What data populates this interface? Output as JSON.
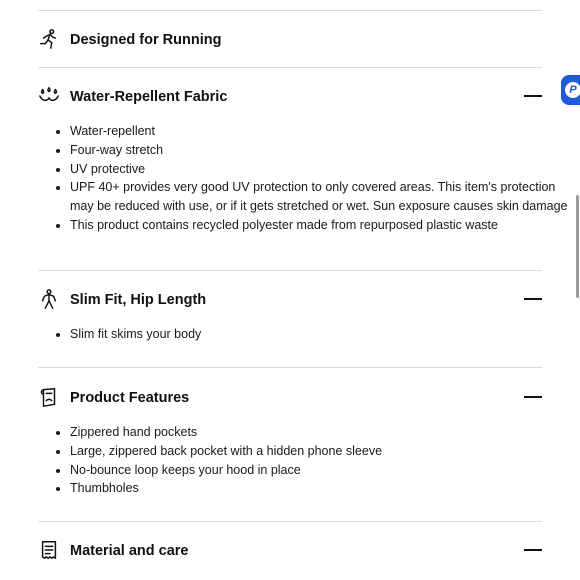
{
  "sections": [
    {
      "title": "Designed for Running",
      "icon": "running-person-icon"
    },
    {
      "title": "Water-Repellent Fabric",
      "icon": "water-drops-icon",
      "expanded": true,
      "items": [
        "Water-repellent",
        "Four-way stretch",
        "UV protective",
        "UPF 40+ provides very good UV protection to only covered areas. This item's protection may be reduced with use, or if it gets stretched or wet. Sun exposure causes skin damage",
        "This product contains recycled polyester made from repurposed plastic waste"
      ]
    },
    {
      "title": "Slim Fit, Hip Length",
      "icon": "body-fit-icon",
      "expanded": true,
      "items": [
        "Slim fit skims your body"
      ]
    },
    {
      "title": "Product Features",
      "icon": "garment-tag-icon",
      "expanded": true,
      "items": [
        "Zippered hand pockets",
        "Large, zippered back pocket with a hidden phone sleeve",
        "No-bounce loop keeps your hood in place",
        "Thumbholes"
      ]
    },
    {
      "title": "Material and care",
      "icon": "care-label-icon",
      "expanded": true
    }
  ],
  "side_badge": {
    "label": "P",
    "icon": "extension-badge-icon",
    "color": "#1f5bd8"
  }
}
